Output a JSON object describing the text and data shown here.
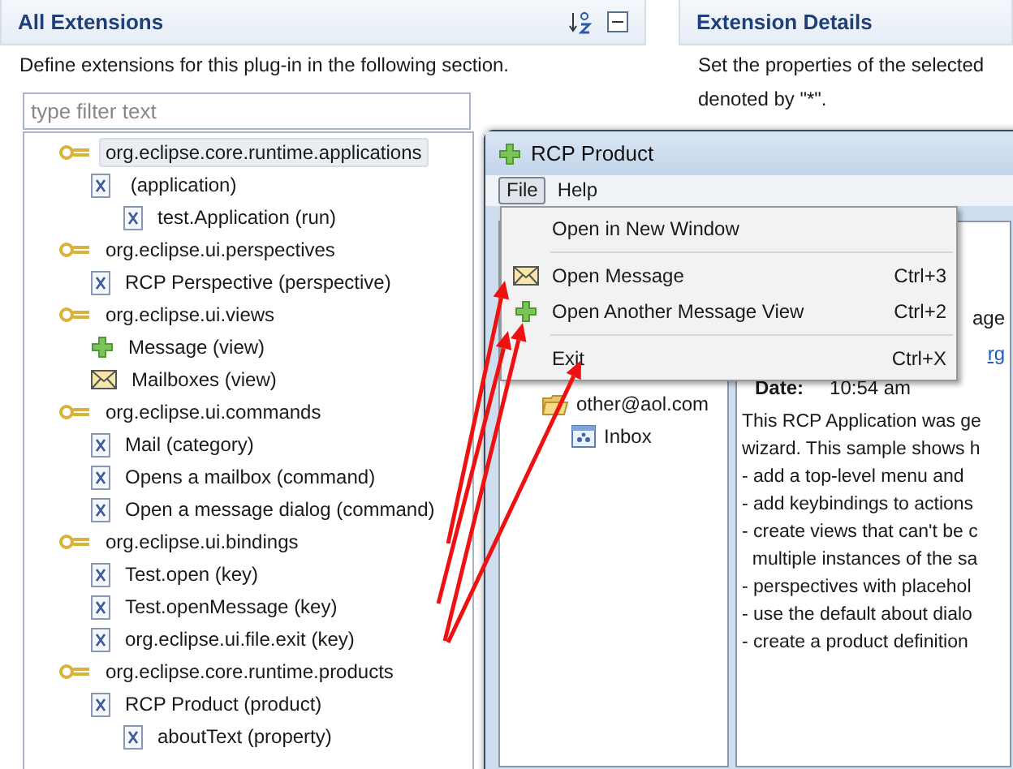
{
  "extensions_panel": {
    "title": "All Extensions",
    "description": "Define extensions for this plug-in in the following section.",
    "filter": {
      "placeholder": "type filter text"
    },
    "tree": [
      {
        "label": "org.eclipse.core.runtime.applications",
        "kind": "point",
        "selected": true,
        "children": [
          {
            "label": " (application)",
            "kind": "element",
            "selected": false,
            "children": [
              {
                "label": "test.Application (run)",
                "kind": "element",
                "selected": false
              }
            ]
          }
        ]
      },
      {
        "label": "org.eclipse.ui.perspectives",
        "kind": "point",
        "selected": false,
        "children": [
          {
            "label": "RCP Perspective (perspective)",
            "kind": "element",
            "selected": false
          }
        ]
      },
      {
        "label": "org.eclipse.ui.views",
        "kind": "point",
        "selected": false,
        "children": [
          {
            "label": "Message (view)",
            "kind": "plus",
            "selected": false
          },
          {
            "label": "Mailboxes (view)",
            "kind": "envelope",
            "selected": false
          }
        ]
      },
      {
        "label": "org.eclipse.ui.commands",
        "kind": "point",
        "selected": false,
        "children": [
          {
            "label": "Mail (category)",
            "kind": "element",
            "selected": false
          },
          {
            "label": "Opens a mailbox (command)",
            "kind": "element",
            "selected": false
          },
          {
            "label": "Open a message dialog (command)",
            "kind": "element",
            "selected": false
          }
        ]
      },
      {
        "label": "org.eclipse.ui.bindings",
        "kind": "point",
        "selected": false,
        "children": [
          {
            "label": "Test.open (key)",
            "kind": "element",
            "selected": false
          },
          {
            "label": "Test.openMessage (key)",
            "kind": "element",
            "selected": false
          },
          {
            "label": "org.eclipse.ui.file.exit (key)",
            "kind": "element",
            "selected": false
          }
        ]
      },
      {
        "label": "org.eclipse.core.runtime.products",
        "kind": "point",
        "selected": false,
        "children": [
          {
            "label": "RCP Product (product)",
            "kind": "element",
            "selected": false,
            "children": [
              {
                "label": "aboutText (property)",
                "kind": "element",
                "selected": false
              }
            ]
          }
        ]
      }
    ]
  },
  "details_panel": {
    "title": "Extension Details",
    "description": [
      "Set the properties of the selected",
      "denoted by \"*\"."
    ]
  },
  "rcp_window": {
    "title": "RCP Product",
    "menus": [
      {
        "label": "File",
        "selected": true
      },
      {
        "label": "Help",
        "selected": false
      }
    ],
    "menu_items": [
      {
        "kind": "item",
        "label": "Open in New Window"
      },
      {
        "kind": "separator"
      },
      {
        "kind": "envelope",
        "label": "Open Message",
        "shortcut": "Ctrl+3"
      },
      {
        "kind": "plus",
        "label": "Open Another Message View",
        "shortcut": "Ctrl+2"
      },
      {
        "kind": "separator"
      },
      {
        "kind": "item",
        "label": "Exit",
        "shortcut": "Ctrl+X"
      }
    ],
    "mail_tree": [
      {
        "label": "other@aol.com",
        "kind": "folder",
        "children": [
          {
            "label": "Inbox",
            "kind": "inbox"
          }
        ]
      }
    ],
    "message": {
      "subject_fragment": "age",
      "link_fragment": "rg",
      "date_label": "Date:",
      "date": "10:54 am",
      "body": [
        "This RCP Application was ge",
        "wizard. This sample shows h",
        "- add a top-level menu and",
        "- add keybindings to actions",
        "- create views that can't be c",
        "  multiple instances of the sa",
        "- perspectives with placehol",
        "- use the default about dialo",
        "- create a product definition"
      ]
    }
  }
}
